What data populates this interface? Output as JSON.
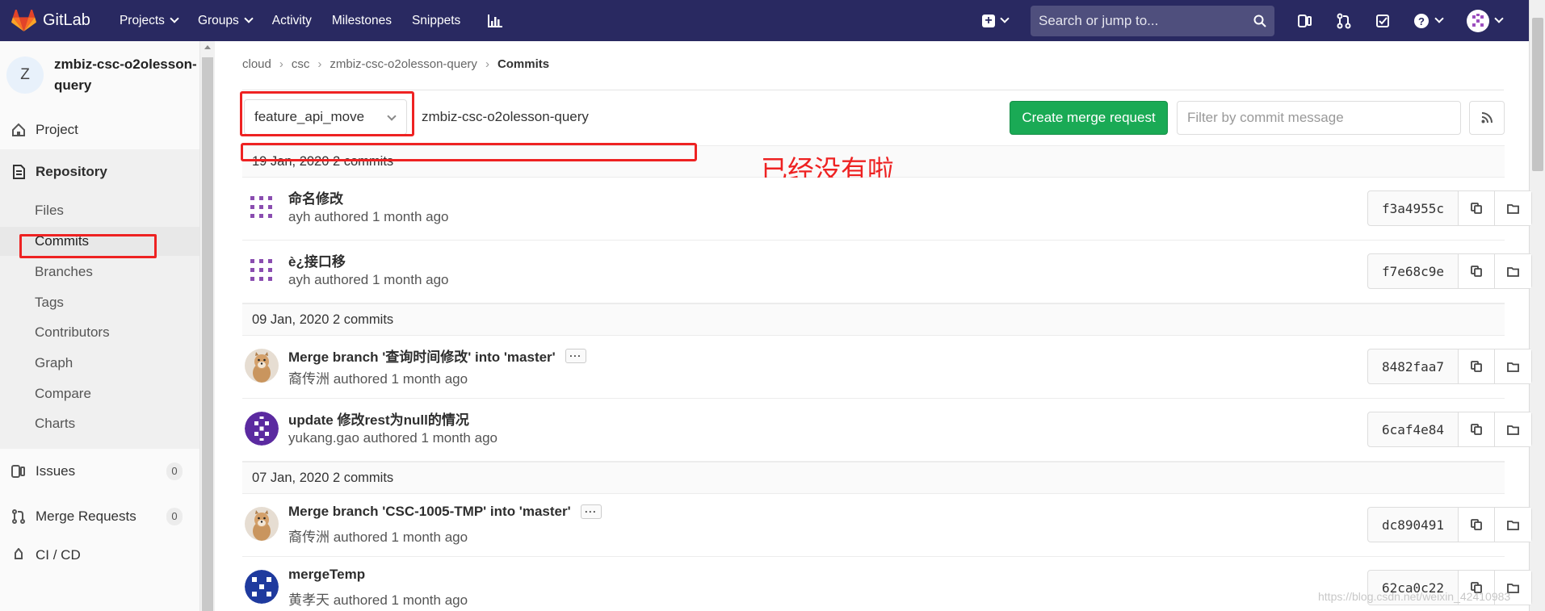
{
  "topnav": {
    "brand": "GitLab",
    "links": [
      "Projects",
      "Groups",
      "Activity",
      "Milestones",
      "Snippets"
    ],
    "search_placeholder": "Search or jump to..."
  },
  "sidebar": {
    "avatar_letter": "Z",
    "project_name": "zmbiz-csc-o2olesson-query",
    "project_label": "Project",
    "repository_label": "Repository",
    "repo_items": [
      "Files",
      "Commits",
      "Branches",
      "Tags",
      "Contributors",
      "Graph",
      "Compare",
      "Charts"
    ],
    "issues_label": "Issues",
    "issues_count": "0",
    "mr_label": "Merge Requests",
    "mr_count": "0",
    "cicd_label": "CI / CD"
  },
  "breadcrumb": [
    "cloud",
    "csc",
    "zmbiz-csc-o2olesson-query",
    "Commits"
  ],
  "toolbar": {
    "branch": "feature_api_move",
    "project_path": "zmbiz-csc-o2olesson-query",
    "create_mr_label": "Create merge request",
    "filter_placeholder": "Filter by commit message"
  },
  "annotation": "已经没有啦",
  "days": [
    {
      "label": "19 Jan, 2020 2 commits"
    },
    {
      "label": "09 Jan, 2020 2 commits"
    },
    {
      "label": "07 Jan, 2020 2 commits"
    }
  ],
  "commits": [
    {
      "title": "命名修改",
      "author": "ayh",
      "meta": " authored 1 month ago",
      "sha": "f3a4955c"
    },
    {
      "title": "è¿接口移",
      "author": "ayh",
      "meta": " authored 1 month ago",
      "sha": "f7e68c9e"
    },
    {
      "title": "Merge branch '查询时间修改' into 'master'",
      "author": "裔传洲",
      "meta": " authored 1 month ago",
      "sha": "8482faa7"
    },
    {
      "title": "update 修改rest为null的情况",
      "author": "yukang.gao",
      "meta": " authored 1 month ago",
      "sha": "6caf4e84"
    },
    {
      "title": "Merge branch 'CSC-1005-TMP' into 'master'",
      "author": "裔传洲",
      "meta": " authored 1 month ago",
      "sha": "dc890491"
    },
    {
      "title": "mergeTemp",
      "author": "黄孝天",
      "meta": " authored 1 month ago",
      "sha": "62ca0c22"
    }
  ],
  "watermark": "https://blog.csdn.net/weixin_42410983",
  "colors": {
    "nav_bg": "#292961",
    "create_btn": "#1aaa55",
    "highlight": "#ee2222"
  }
}
